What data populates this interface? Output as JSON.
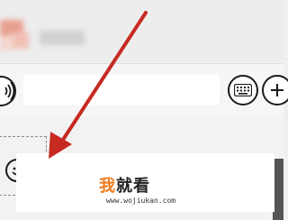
{
  "watermark": {
    "logo_char1": "我",
    "logo_rest": "就看",
    "url": "www.wojiukan.com"
  },
  "icons": {
    "voice": "voice-wave-icon",
    "keyboard": "keyboard-icon",
    "plus": "plus-icon",
    "emoji": "emoji-icon",
    "arrow": "red-arrow-annotation"
  },
  "colors": {
    "arrow": "#c62a21",
    "logo_accent": "#f07a1c"
  }
}
